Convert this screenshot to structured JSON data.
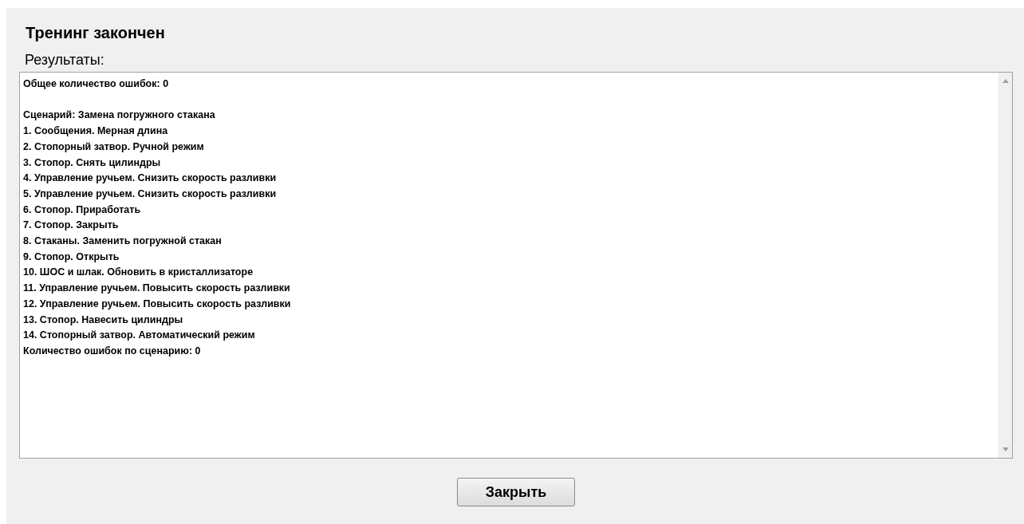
{
  "title": "Тренинг закончен",
  "results_label": "Результаты:",
  "results": {
    "total": "Общее количество ошибок: 0",
    "scenario": {
      "title": "Сценарий: Замена погружного стакана",
      "steps": [
        "1. Сообщения. Мерная длина",
        "2. Стопорный затвор. Ручной режим",
        "3. Стопор. Снять цилиндры",
        "4. Управление ручьем. Снизить скорость разливки",
        "5. Управление ручьем. Снизить скорость разливки",
        "6. Стопор. Приработать",
        "7. Стопор. Закрыть",
        "8. Стаканы. Заменить погружной стакан",
        "9. Стопор. Открыть",
        "10. ШОС и шлак. Обновить в кристаллизаторе",
        "11. Управление ручьем. Повысить скорость разливки",
        "12. Управление ручьем. Повысить скорость разливки",
        "13. Стопор. Навесить цилиндры",
        "14. Стопорный затвор. Автоматический режим"
      ],
      "errors": "Количество ошибок по сценарию: 0"
    }
  },
  "button": "Закрыть"
}
